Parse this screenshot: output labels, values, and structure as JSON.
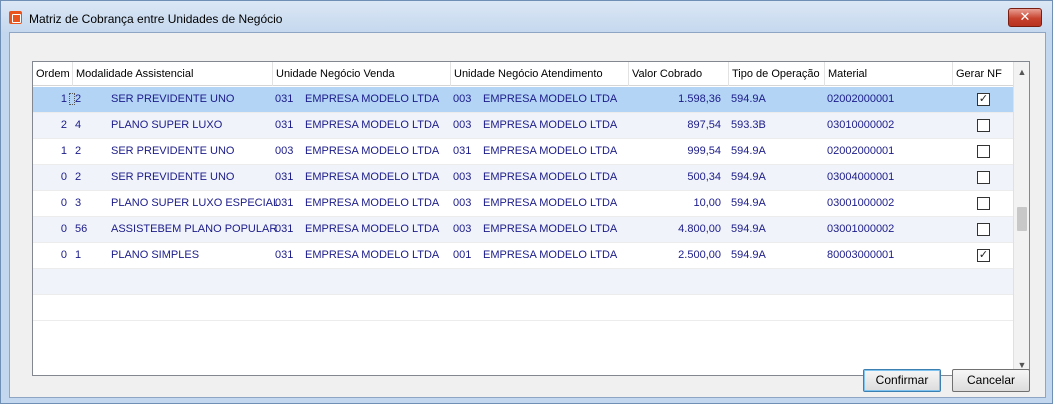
{
  "window": {
    "title": "Matriz de Cobrança entre Unidades de Negócio",
    "close_label": "✕"
  },
  "grid": {
    "headers": [
      "Ordem",
      "Modalidade Assistencial",
      "Unidade Negócio Venda",
      "Unidade Negócio Atendimento",
      "Valor Cobrado",
      "Tipo de Operação",
      "Material",
      "Gerar NF"
    ],
    "rows": [
      {
        "ordem": "1",
        "mod_cod": "2",
        "mod_nome": "SER PREVIDENTE UNO",
        "venda_cod": "031",
        "venda_nome": "EMPRESA MODELO LTDA",
        "atend_cod": "003",
        "atend_nome": "EMPRESA MODELO LTDA",
        "valor": "1.598,36",
        "tipo": "594.9A",
        "material": "02002000001",
        "gerar_nf": true
      },
      {
        "ordem": "2",
        "mod_cod": "4",
        "mod_nome": "PLANO SUPER LUXO",
        "venda_cod": "031",
        "venda_nome": "EMPRESA MODELO LTDA",
        "atend_cod": "003",
        "atend_nome": "EMPRESA MODELO LTDA",
        "valor": "897,54",
        "tipo": "593.3B",
        "material": "03010000002",
        "gerar_nf": false
      },
      {
        "ordem": "1",
        "mod_cod": "2",
        "mod_nome": "SER PREVIDENTE UNO",
        "venda_cod": "003",
        "venda_nome": "EMPRESA MODELO LTDA",
        "atend_cod": "031",
        "atend_nome": "EMPRESA MODELO LTDA",
        "valor": "999,54",
        "tipo": "594.9A",
        "material": "02002000001",
        "gerar_nf": false
      },
      {
        "ordem": "0",
        "mod_cod": "2",
        "mod_nome": "SER PREVIDENTE UNO",
        "venda_cod": "031",
        "venda_nome": "EMPRESA MODELO LTDA",
        "atend_cod": "003",
        "atend_nome": "EMPRESA MODELO LTDA",
        "valor": "500,34",
        "tipo": "594.9A",
        "material": "03004000001",
        "gerar_nf": false
      },
      {
        "ordem": "0",
        "mod_cod": "3",
        "mod_nome": "PLANO SUPER LUXO ESPECIAL",
        "venda_cod": "031",
        "venda_nome": "EMPRESA MODELO LTDA",
        "atend_cod": "003",
        "atend_nome": "EMPRESA MODELO LTDA",
        "valor": "10,00",
        "tipo": "594.9A",
        "material": "03001000002",
        "gerar_nf": false
      },
      {
        "ordem": "0",
        "mod_cod": "56",
        "mod_nome": "ASSISTEBEM PLANO POPULAR",
        "venda_cod": "031",
        "venda_nome": "EMPRESA MODELO LTDA",
        "atend_cod": "003",
        "atend_nome": "EMPRESA MODELO LTDA",
        "valor": "4.800,00",
        "tipo": "594.9A",
        "material": "03001000002",
        "gerar_nf": false
      },
      {
        "ordem": "0",
        "mod_cod": "1",
        "mod_nome": "PLANO SIMPLES",
        "venda_cod": "031",
        "venda_nome": "EMPRESA MODELO LTDA",
        "atend_cod": "001",
        "atend_nome": "EMPRESA MODELO LTDA",
        "valor": "2.500,00",
        "tipo": "594.9A",
        "material": "80003000001",
        "gerar_nf": true
      }
    ],
    "empty_rows": 2,
    "selected_row": 0,
    "scroll_position": 0.5
  },
  "buttons": {
    "confirm": "Confirmar",
    "cancel": "Cancelar"
  },
  "colors": {
    "selected_row": "#b3d4f5",
    "text": "#1b1b8a",
    "close_button": "#c7432e"
  }
}
